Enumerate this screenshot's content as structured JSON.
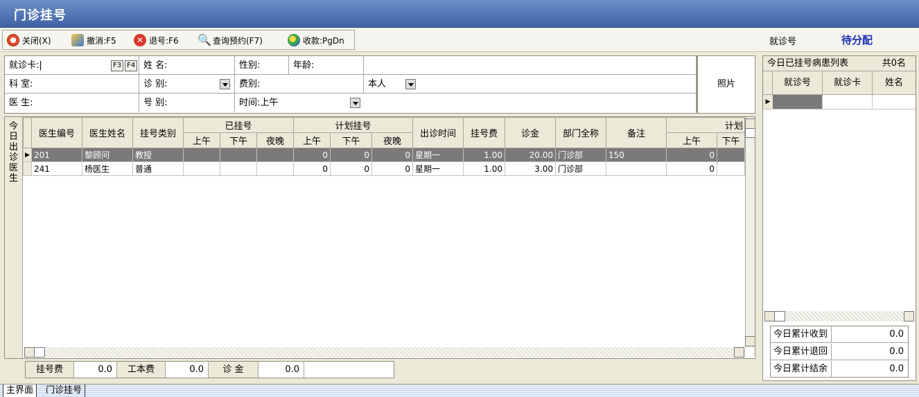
{
  "window": {
    "title": "门诊挂号"
  },
  "toolbar": {
    "close": "关闭(X)",
    "undo": "撤消:F5",
    "refund": "退号:F6",
    "query": "查询预约(F7)",
    "charge": "收款:PgDn",
    "visit_no_label": "就诊号",
    "visit_status": "待分配"
  },
  "form": {
    "card_label": "就诊卡:",
    "card_value": "|",
    "f3": "F3",
    "f4": "F4",
    "name_label": "姓  名:",
    "gender_label": "性别:",
    "age_label": "年龄:",
    "dept_label": "科  室:",
    "clinic_label": "诊  别:",
    "fee_label": "费别:",
    "fee_value": "本人",
    "doctor_label": "医  生:",
    "reg_type_label": "号  别:",
    "time_label": "时间:",
    "time_value": "上午",
    "photo": "照片"
  },
  "grid": {
    "side_tab": "今日出诊医生",
    "headers": {
      "doctor_id": "医生编号",
      "doctor_name": "医生姓名",
      "reg_type": "挂号类别",
      "registered": "已挂号",
      "planned": "计划挂号",
      "am": "上午",
      "pm": "下午",
      "night": "夜晚",
      "schedule": "出诊时间",
      "reg_fee": "挂号费",
      "consult_fee": "诊金",
      "dept_full": "部门全称",
      "remark": "备注",
      "plan2": "计划",
      "am2": "上午",
      "pm2": "下午"
    },
    "rows": [
      {
        "id": "201",
        "name": "黎顾问",
        "type": "教授",
        "r_am": "",
        "r_pm": "",
        "r_night": "",
        "p_am": "0",
        "p_pm": "0",
        "p_night": "0",
        "schedule": "星期一",
        "reg_fee": "1.00",
        "consult_fee": "20.00",
        "dept": "门诊部",
        "remark": "150",
        "p2_am": "0",
        "p2_pm": ""
      },
      {
        "id": "241",
        "name": "杨医生",
        "type": "普通",
        "r_am": "",
        "r_pm": "",
        "r_night": "",
        "p_am": "0",
        "p_pm": "0",
        "p_night": "0",
        "schedule": "星期一",
        "reg_fee": "1.00",
        "consult_fee": "3.00",
        "dept": "门诊部",
        "remark": "",
        "p2_am": "0",
        "p2_pm": ""
      }
    ]
  },
  "totals": {
    "reg_fee_label": "挂号费",
    "reg_fee": "0.0",
    "book_fee_label": "工本费",
    "book_fee": "0.0",
    "consult_label": "诊  金",
    "consult": "0.0"
  },
  "right_panel": {
    "title": "今日已挂号病患列表",
    "count": "共0名",
    "col_visit": "就诊号",
    "col_card": "就诊卡",
    "col_name": "姓名",
    "summary": [
      {
        "label": "今日累计收到",
        "value": "0.0"
      },
      {
        "label": "今日累计退回",
        "value": "0.0"
      },
      {
        "label": "今日累计结余",
        "value": "0.0"
      }
    ]
  },
  "tabs": [
    "主界面",
    "门诊挂号"
  ],
  "colors": {
    "title_bar": "#3f62a6",
    "selected_row": "#7a7a7a",
    "status_blue": "#1a2fb8"
  }
}
